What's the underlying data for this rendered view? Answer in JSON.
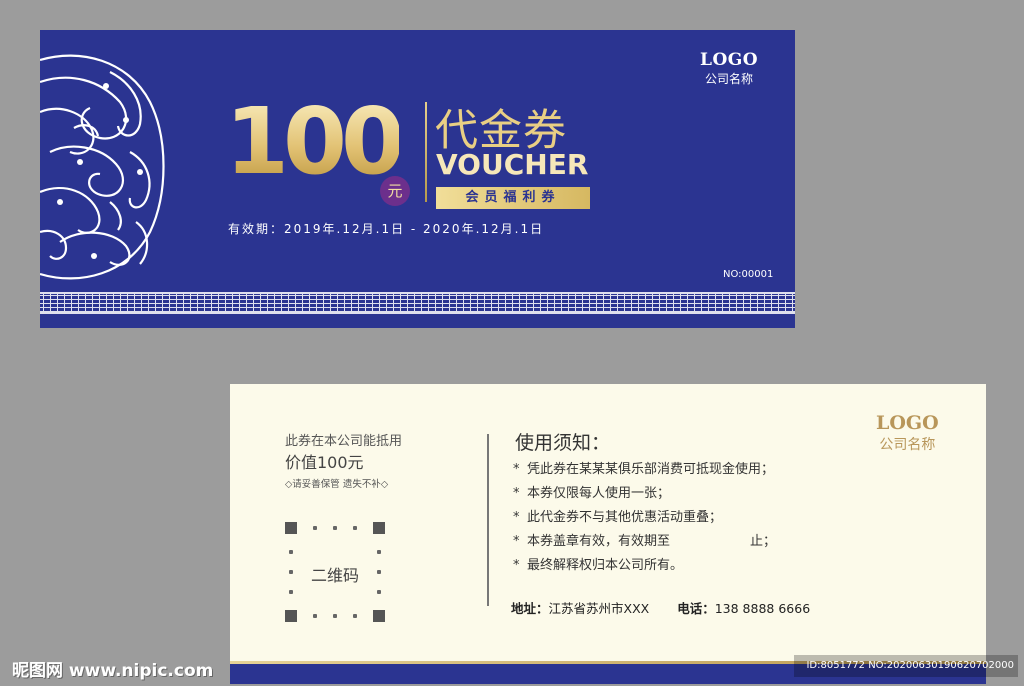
{
  "front": {
    "logo": "LOGO",
    "company": "公司名称",
    "value": "100",
    "currency": "元",
    "title_cn": "代金券",
    "title_en": "VOUCHER",
    "member": "会员福利券",
    "validity": "有效期：2019年.12月.1日 - 2020年.12月.1日",
    "serial": "NO:00001"
  },
  "back": {
    "usable": "此券在本公司能抵用",
    "value": "价值100元",
    "keep": "◇请妥善保管 遗失不补◇",
    "qr_label": "二维码",
    "notice_title": "使用须知：",
    "bullet": "*",
    "rules": [
      "凭此券在某某某俱乐部消费可抵现金使用；",
      "本券仅限每人使用一张；",
      "此代金券不与其他优惠活动重叠；",
      "本券盖章有效，有效期至",
      "最终解释权归本公司所有。"
    ],
    "rule4_end": "止；",
    "address_label": "地址：",
    "address_value": "江苏省苏州市XXX",
    "phone_label": "电话：",
    "phone_value": "138 8888 6666",
    "logo": "LOGO",
    "company": "公司名称"
  },
  "watermark": {
    "site": "昵图网 www.nipic.com",
    "id": "ID:8051772 NO:20200630190620702000"
  },
  "colors": {
    "navy": "#2b3491",
    "gold": "#e6cf84",
    "cream": "#fcfaea"
  }
}
